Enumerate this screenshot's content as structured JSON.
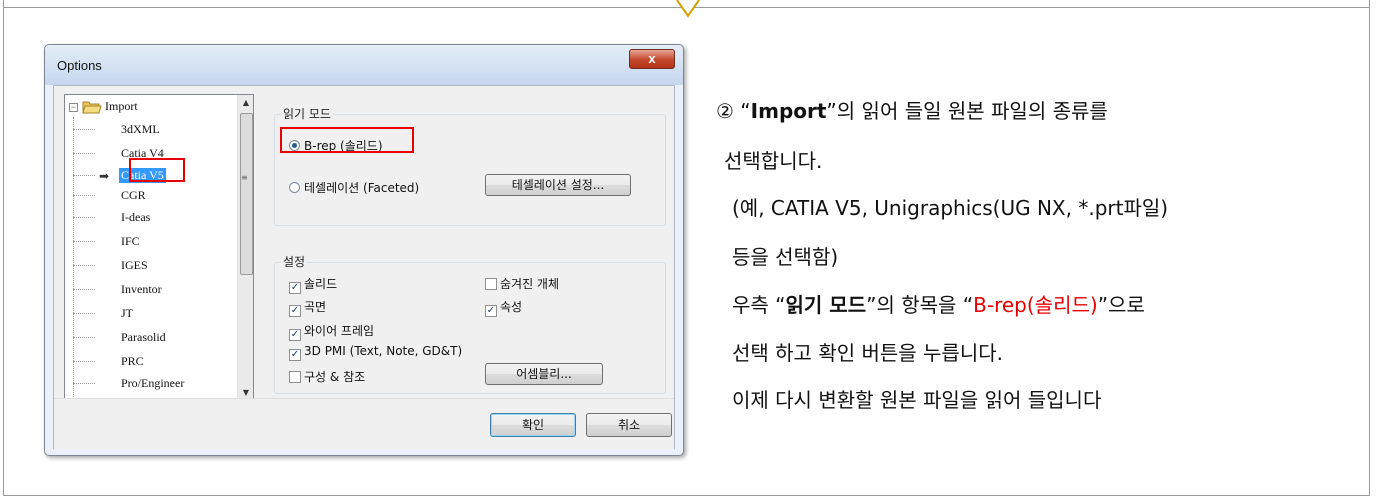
{
  "dialog": {
    "title": "Options",
    "close_label": "x",
    "tree": {
      "root": "Import",
      "items": [
        "3dXML",
        "Catia V4",
        "Catia V5",
        "CGR",
        "I-deas",
        "IFC",
        "IGES",
        "Inventor",
        "JT",
        "Parasolid",
        "PRC",
        "Pro/Engineer"
      ],
      "selected": "Catia V5"
    },
    "read_mode": {
      "label": "읽기 모드",
      "option_brep": "B-rep (솔리드)",
      "option_faceted": "테셀레이션 (Faceted)",
      "tess_button": "테셀레이션 설정..."
    },
    "settings": {
      "label": "설정",
      "solid": "솔리드",
      "surface": "곡면",
      "wireframe": "와이어 프레임",
      "pmi": "3D PMI (Text, Note, GD&T)",
      "structure": "구성 & 참조",
      "hidden": "숨겨진 개체",
      "attributes": "속성",
      "assembly_button": "어셈블리..."
    },
    "ok_label": "확인",
    "cancel_label": "취소"
  },
  "instructions": {
    "line1_prefix": "② “",
    "line1_bold": "Import",
    "line1_suffix": "”의 읽어 들일 원본 파일의 종류를",
    "line2": "선택합니다.",
    "line3": "(예, CATIA V5, Unigraphics(UG NX, *.prt파일)",
    "line4": "등을 선택함)",
    "line5_prefix": "우측 “",
    "line5_bold": "읽기 모드",
    "line5_mid": "”의 항목을 “",
    "line5_red": "B-rep(솔리드)",
    "line5_suffix": "”으로",
    "line6": "선택 하고 확인 버튼을 누릅니다.",
    "line7": "이제 다시 변환할 원본 파일을 읽어 들입니다"
  },
  "colors": {
    "highlight_red": "#e60000",
    "selection_blue": "#3399ff"
  }
}
